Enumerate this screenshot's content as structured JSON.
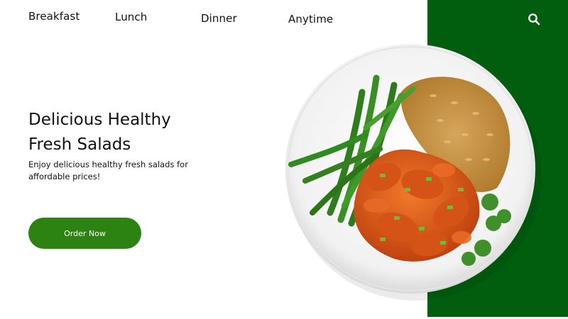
{
  "nav": {
    "items": [
      {
        "label": "Breakfast"
      },
      {
        "label": "Lunch"
      },
      {
        "label": "Dinner"
      },
      {
        "label": "Anytime"
      }
    ],
    "search_icon": "search-icon"
  },
  "hero": {
    "title_line1": "Delicious Healthy",
    "title_line2": "Fresh Salads",
    "description": "Enjoy delicious healthy fresh salads for affordable prices!",
    "cta_label": "Order Now"
  },
  "image": {
    "subject": "plate-of-food-icon"
  },
  "colors": {
    "panel": "#005e0e",
    "button": "#2c8311"
  }
}
